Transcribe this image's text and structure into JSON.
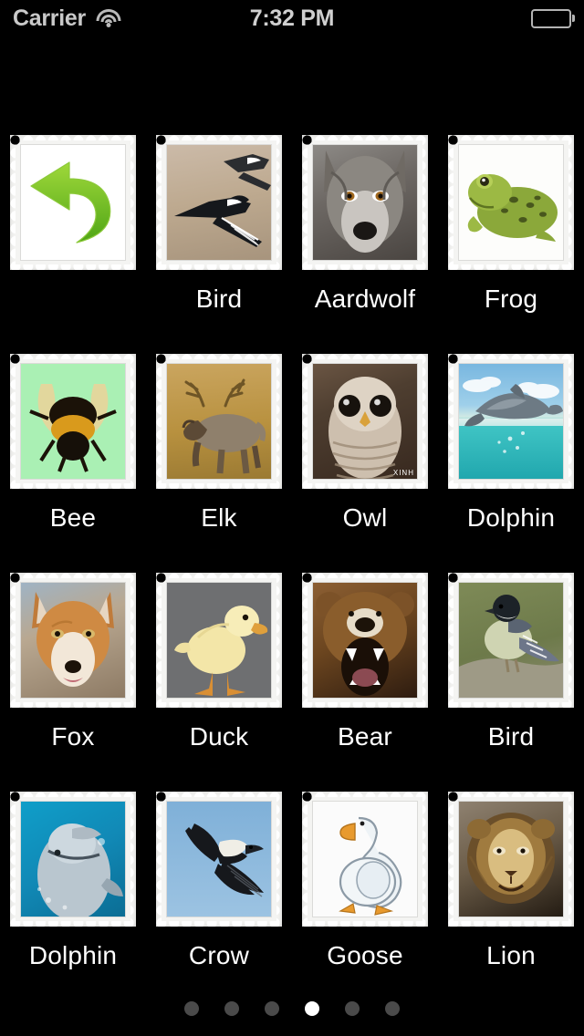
{
  "status_bar": {
    "carrier": "Carrier",
    "wifi_icon": "wifi-icon",
    "time": "7:32 PM",
    "battery_icon": "battery-full-icon"
  },
  "screen": {
    "background_color": "#000000",
    "label_color": "#ffffff"
  },
  "grid": {
    "columns": 4,
    "rows": 4,
    "cells": [
      {
        "type": "back",
        "label": "",
        "icon": "back-arrow-icon",
        "accent": "#6cbf2b"
      },
      {
        "type": "stamp",
        "label": "Bird",
        "art": "a-bird1"
      },
      {
        "type": "stamp",
        "label": "Aardwolf",
        "art": "a-wolf"
      },
      {
        "type": "stamp",
        "label": "Frog",
        "art": "a-frog"
      },
      {
        "type": "stamp",
        "label": "Bee",
        "art": "a-bee"
      },
      {
        "type": "stamp",
        "label": "Elk",
        "art": "a-elk"
      },
      {
        "type": "stamp",
        "label": "Owl",
        "art": "a-owl",
        "watermark": "XINH"
      },
      {
        "type": "stamp",
        "label": "Dolphin",
        "art": "a-dolphin1"
      },
      {
        "type": "stamp",
        "label": "Fox",
        "art": "a-fox"
      },
      {
        "type": "stamp",
        "label": "Duck",
        "art": "a-duck"
      },
      {
        "type": "stamp",
        "label": "Bear",
        "art": "a-bear"
      },
      {
        "type": "stamp",
        "label": "Bird",
        "art": "a-bird2"
      },
      {
        "type": "stamp",
        "label": "Dolphin",
        "art": "a-dolphin2"
      },
      {
        "type": "stamp",
        "label": "Crow",
        "art": "a-crow"
      },
      {
        "type": "stamp",
        "label": "Goose",
        "art": "a-goose"
      },
      {
        "type": "stamp",
        "label": "Lion",
        "art": "a-lion"
      }
    ]
  },
  "pagination": {
    "total": 6,
    "current": 4,
    "active_color": "#ffffff",
    "inactive_color": "#4a4a4a"
  }
}
